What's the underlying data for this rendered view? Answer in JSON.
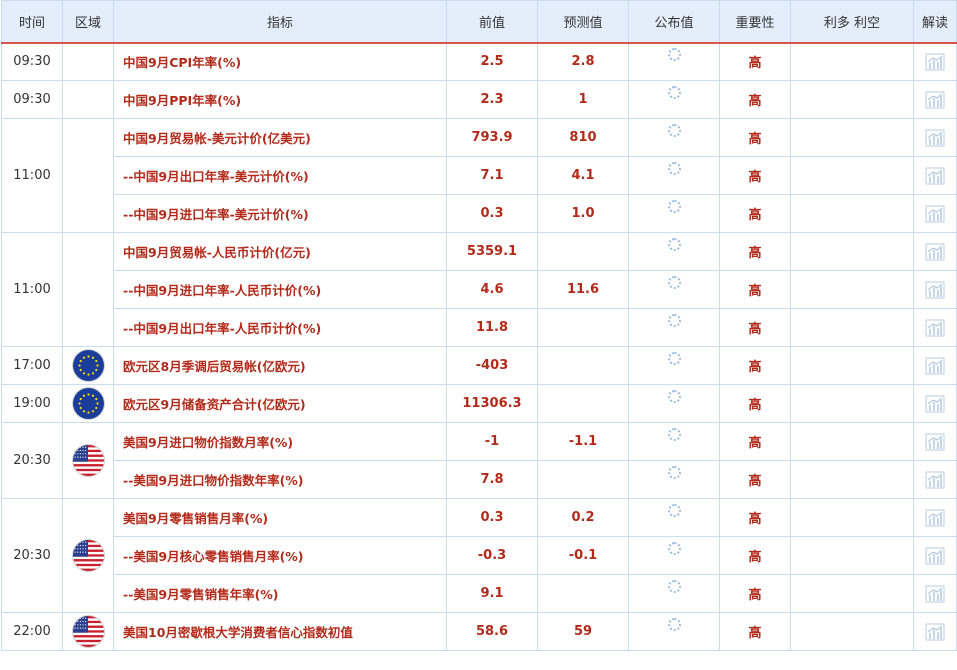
{
  "header": {
    "time": "时间",
    "region": "区域",
    "indicator": "指标",
    "previous": "前值",
    "forecast": "预测值",
    "actual": "公布值",
    "importance": "重要性",
    "bullbear": "利多 利空",
    "interpret": "解读"
  },
  "groups": [
    {
      "time": "09:30",
      "flag": "",
      "rows": [
        {
          "indicator": "中国9月CPI年率(%)",
          "previous": "2.5",
          "forecast": "2.8",
          "importance": "高"
        }
      ]
    },
    {
      "time": "09:30",
      "flag": "",
      "rows": [
        {
          "indicator": "中国9月PPI年率(%)",
          "previous": "2.3",
          "forecast": "1",
          "importance": "高"
        }
      ]
    },
    {
      "time": "11:00",
      "flag": "",
      "rows": [
        {
          "indicator": "中国9月贸易帐-美元计价(亿美元)",
          "previous": "793.9",
          "forecast": "810",
          "importance": "高"
        },
        {
          "indicator": "--中国9月出口年率-美元计价(%)",
          "previous": "7.1",
          "forecast": "4.1",
          "importance": "高"
        },
        {
          "indicator": "--中国9月进口年率-美元计价(%)",
          "previous": "0.3",
          "forecast": "1.0",
          "importance": "高"
        }
      ]
    },
    {
      "time": "11:00",
      "flag": "",
      "rows": [
        {
          "indicator": "中国9月贸易帐-人民币计价(亿元)",
          "previous": "5359.1",
          "forecast": "",
          "importance": "高"
        },
        {
          "indicator": "--中国9月进口年率-人民币计价(%)",
          "previous": "4.6",
          "forecast": "11.6",
          "importance": "高"
        },
        {
          "indicator": "--中国9月出口年率-人民币计价(%)",
          "previous": "11.8",
          "forecast": "",
          "importance": "高"
        }
      ]
    },
    {
      "time": "17:00",
      "flag": "eu",
      "rows": [
        {
          "indicator": "欧元区8月季调后贸易帐(亿欧元)",
          "previous": "-403",
          "forecast": "",
          "importance": "高"
        }
      ]
    },
    {
      "time": "19:00",
      "flag": "eu",
      "rows": [
        {
          "indicator": "欧元区9月储备资产合计(亿欧元)",
          "previous": "11306.3",
          "forecast": "",
          "importance": "高"
        }
      ]
    },
    {
      "time": "20:30",
      "flag": "us",
      "rows": [
        {
          "indicator": "美国9月进口物价指数月率(%)",
          "previous": "-1",
          "forecast": "-1.1",
          "importance": "高"
        },
        {
          "indicator": "--美国9月进口物价指数年率(%)",
          "previous": "7.8",
          "forecast": "",
          "importance": "高"
        }
      ]
    },
    {
      "time": "20:30",
      "flag": "us",
      "rows": [
        {
          "indicator": "美国9月零售销售月率(%)",
          "previous": "0.3",
          "forecast": "0.2",
          "importance": "高"
        },
        {
          "indicator": "--美国9月核心零售销售月率(%)",
          "previous": "-0.3",
          "forecast": "-0.1",
          "importance": "高"
        },
        {
          "indicator": "--美国9月零售销售年率(%)",
          "previous": "9.1",
          "forecast": "",
          "importance": "高"
        }
      ]
    },
    {
      "time": "22:00",
      "flag": "us",
      "rows": [
        {
          "indicator": "美国10月密歇根大学消费者信心指数初值",
          "previous": "58.6",
          "forecast": "59",
          "importance": "高"
        }
      ]
    }
  ],
  "icons": {
    "actual_pending": "loading-spinner-icon",
    "interpret": "chart-report-icon",
    "eu_flag": "eu-flag-icon",
    "us_flag": "us-flag-icon"
  },
  "colors": {
    "header_bg": "#e4eefb",
    "header_underline": "#d9534f",
    "value_red": "#b32a1a",
    "border": "#c9dcef"
  }
}
